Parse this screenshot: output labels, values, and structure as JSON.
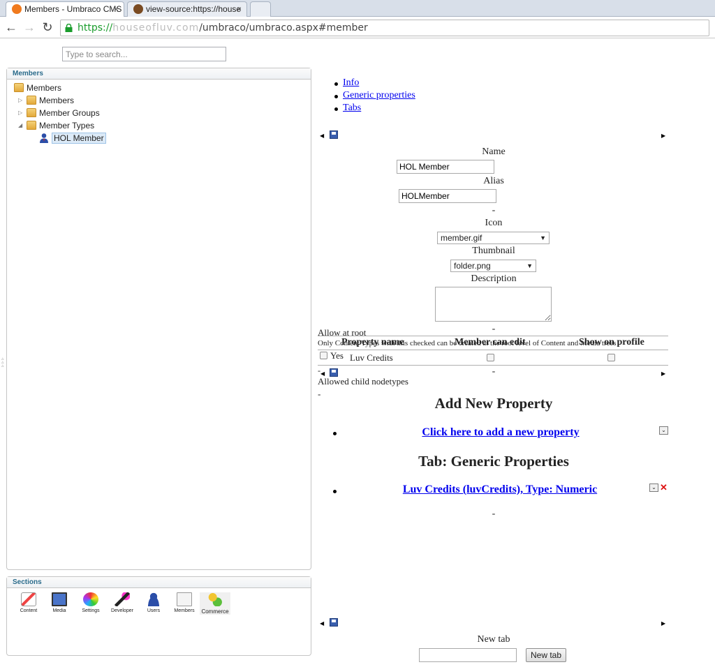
{
  "browser": {
    "tabs": [
      {
        "title": "Members - Umbraco CMS",
        "close": "×"
      },
      {
        "title": "view-source:https://house",
        "close": "×"
      }
    ],
    "address": {
      "scheme": "https://",
      "host_blurred": "houseofluv.com",
      "path": "/umbraco/umbraco.aspx#member"
    }
  },
  "search": {
    "placeholder": "Type to search..."
  },
  "tree": {
    "header": "Members",
    "nodes": [
      {
        "label": "Members"
      },
      {
        "label": "Members"
      },
      {
        "label": "Member Groups"
      },
      {
        "label": "Member Types"
      },
      {
        "label": "HOL Member"
      }
    ]
  },
  "sections": {
    "header": "Sections",
    "items": [
      {
        "label": "Content",
        "icon": "pencil-document-icon"
      },
      {
        "label": "Media",
        "icon": "monitor-icon"
      },
      {
        "label": "Settings",
        "icon": "color-wheel-icon"
      },
      {
        "label": "Developer",
        "icon": "magic-wand-icon"
      },
      {
        "label": "Users",
        "icon": "user-icon"
      },
      {
        "label": "Members",
        "icon": "id-card-icon"
      },
      {
        "label": "Commerce",
        "icon": "commerce-icon"
      }
    ]
  },
  "editor": {
    "tabs": [
      "Info",
      "Generic properties",
      "Tabs"
    ],
    "name_label": "Name",
    "name_value": "HOL Member",
    "alias_label": "Alias",
    "alias_value": "HOLMember",
    "dash": "-",
    "icon_label": "Icon",
    "icon_value": "member.gif",
    "thumbnail_label": "Thumbnail",
    "thumbnail_value": "folder.png",
    "description_label": "Description",
    "allow_root_label": "Allow at root",
    "allow_root_hint": "Only Content Types with this checked can be created at the root level of Content and Media trees",
    "yes_label": "Yes",
    "allowed_child_label": "Allowed child nodetypes",
    "member_props": {
      "columns": [
        "Property name",
        "Member can edit",
        "Show on profile"
      ],
      "rows": [
        {
          "name": "Luv Credits"
        }
      ]
    },
    "add_property_heading": "Add New Property",
    "add_property_link": "Click here to add a new property",
    "tab_heading": "Tab: Generic Properties",
    "property_link": "Luv Credits (luvCredits), Type: Numeric",
    "new_tab_label": "New tab",
    "new_tab_button": "New tab"
  }
}
